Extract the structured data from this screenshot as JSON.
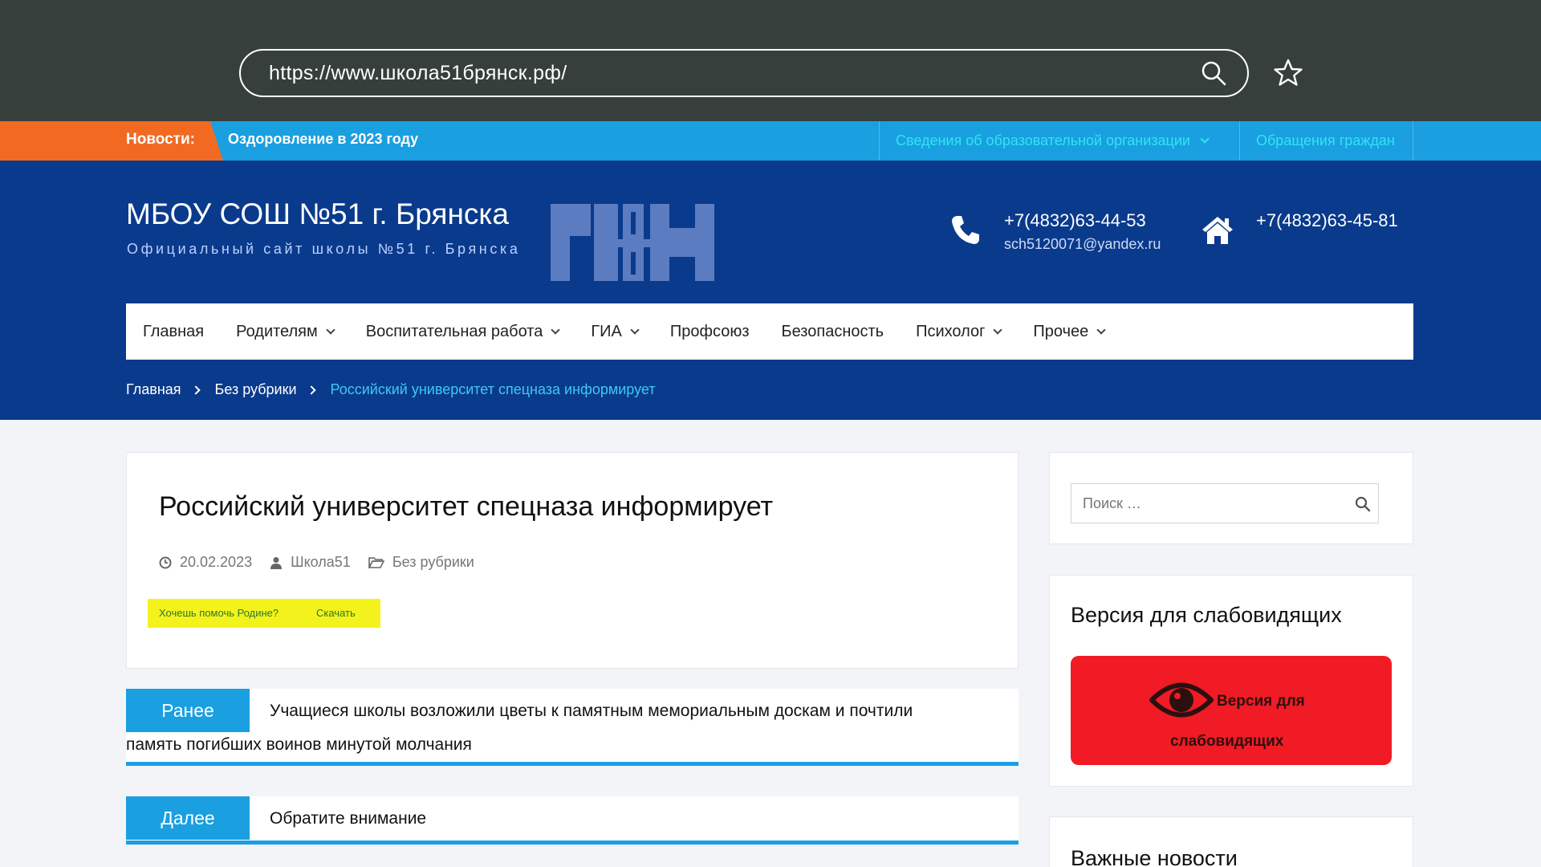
{
  "browser": {
    "url": "https://www.школа51брянск.рф/",
    "search_icon": "search-icon",
    "bookmark_icon": "star-icon"
  },
  "top_strip": {
    "news_label": "Новости:",
    "news_headline": "Оздоровление в 2023 году",
    "links": [
      "Сведения об образовательной организации",
      "Обращения граждан"
    ]
  },
  "header": {
    "title": "МБОУ СОШ №51 г. Брянска",
    "subtitle": "Официальный сайт школы №51 г. Брянска",
    "phone1": "+7(4832)63-44-53",
    "email": "sch5120071@yandex.ru",
    "phone2": "+7(4832)63-45-81"
  },
  "nav": {
    "items": [
      {
        "label": "Главная"
      },
      {
        "label": "Родителям"
      },
      {
        "label": "Воспитательная работа"
      },
      {
        "label": "ГИА"
      },
      {
        "label": "Профсоюз"
      },
      {
        "label": "Безопасность"
      },
      {
        "label": "Психолог"
      },
      {
        "label": "Прочее"
      }
    ]
  },
  "breadcrumb": {
    "home": "Главная",
    "category": "Без рубрики",
    "current": "Российский университет спецназа информирует"
  },
  "article": {
    "title": "Российский университет спецназа информирует",
    "date": "20.02.2023",
    "author": "Школа51",
    "category": "Без рубрики",
    "highlight_text": "Хочешь помочь Родине?",
    "highlight_link": "Скачать"
  },
  "postnav": {
    "prev_label": "Ранее",
    "prev_title_line1": "Учащиеся школы возложили цветы к памятным мемориальным доскам и почтили",
    "prev_title_line2": "память погибших воинов минутой молчания",
    "next_label": "Далее",
    "next_title": "Обратите внимание"
  },
  "sidebar": {
    "search_placeholder": "Поиск …",
    "vision_title": "Версия для слабовидящих",
    "vision_button_line1": "Версия для",
    "vision_button_line2": "слабовидящих",
    "news_title": "Важные новости"
  },
  "colors": {
    "browser_bar": "#363f3b",
    "strip_blue": "#1a9fe0",
    "news_orange": "#f26a22",
    "header_navy": "#0a3a8c",
    "vision_red": "#f01b24",
    "highlight_yellow": "#f4f21c"
  }
}
